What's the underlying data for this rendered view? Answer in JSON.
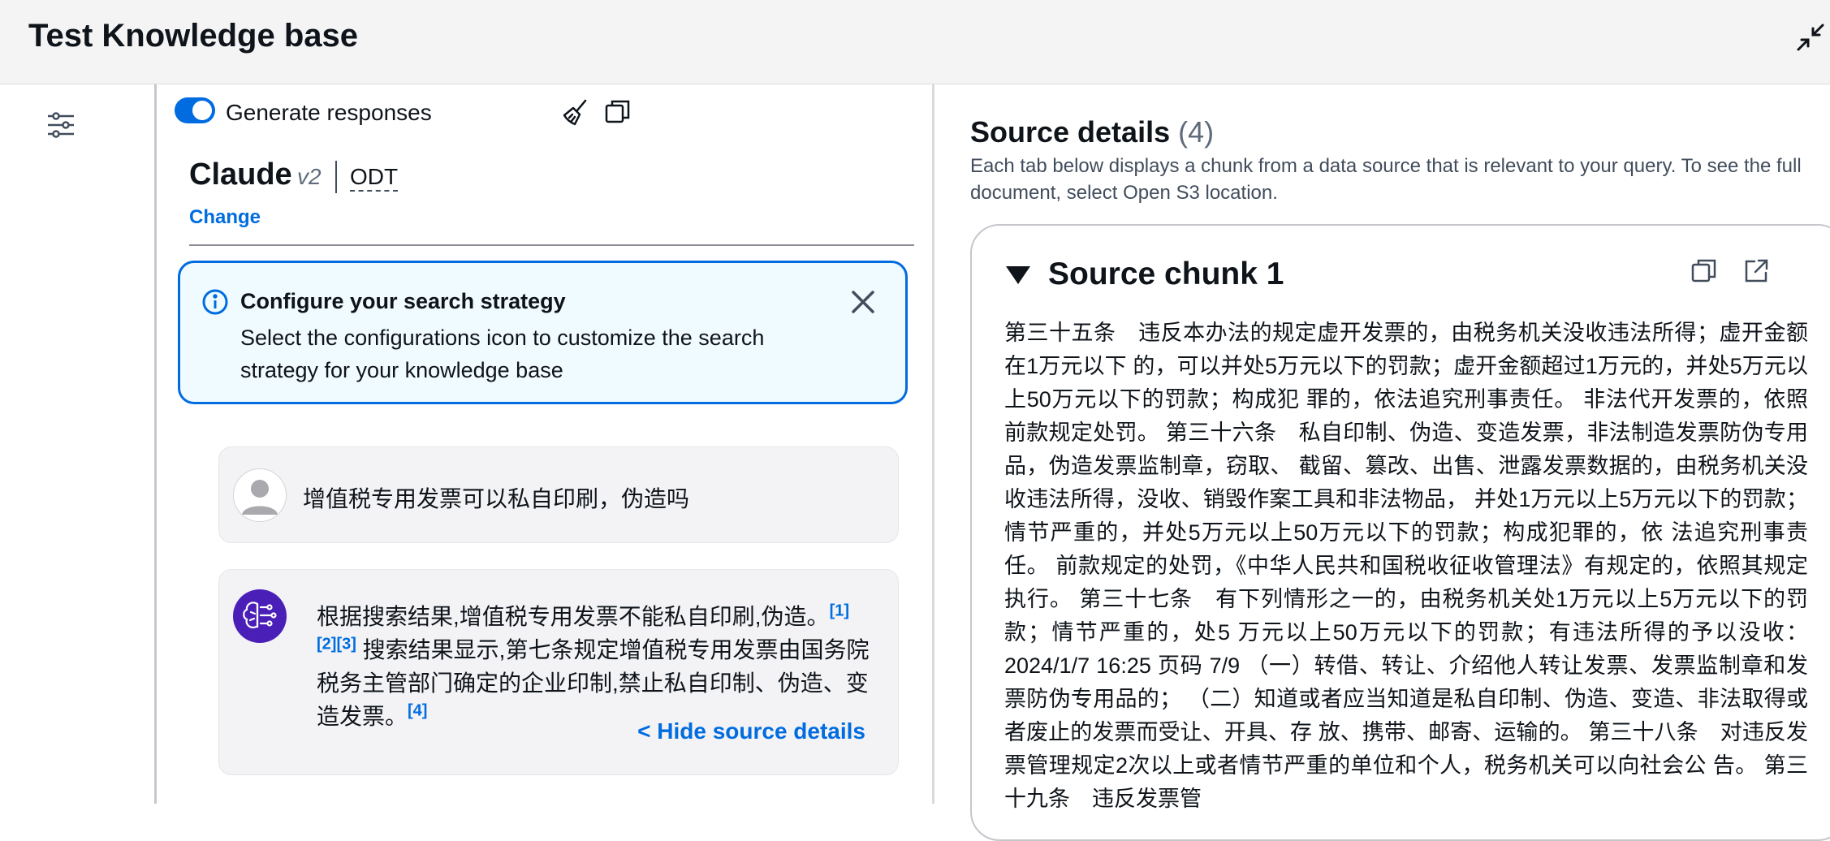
{
  "header": {
    "title": "Test Knowledge base"
  },
  "chat": {
    "generate_label": "Generate responses",
    "generate_enabled": true,
    "model": {
      "name": "Claude",
      "version": "v2",
      "tag": "ODT",
      "change_label": "Change"
    },
    "alert": {
      "title": "Configure your search strategy",
      "body": "Select the configurations icon to customize the search strategy for your knowledge base"
    },
    "user_message": "增值税专用发票可以私自印刷，伪造吗",
    "bot_message": {
      "part1": "根据搜索结果,增值税专用发票不能私自印刷,伪造。",
      "cite1": "[1]",
      "cite2": "[2]",
      "cite3": "[3]",
      "part2": " 搜索结果显示,第七条规定增值税专用发票由国务院税务主管部门确定的企业印制,禁止私自印制、伪造、变造发票。",
      "cite4": "[4]",
      "hide_label": "< Hide source details"
    }
  },
  "source": {
    "title": "Source details",
    "count": "(4)",
    "description": "Each tab below displays a chunk from a data source that is relevant to your query. To see the full document, select Open S3 location.",
    "chunk": {
      "title": "Source chunk 1",
      "text": "第三十五条　违反本办法的规定虚开发票的，由税务机关没收违法所得；虚开金额在1万元以下 的，可以并处5万元以下的罚款；虚开金额超过1万元的，并处5万元以上50万元以下的罚款；构成犯 罪的，依法追究刑事责任。 非法代开发票的，依照前款规定处罚。 第三十六条　私自印制、伪造、变造发票，非法制造发票防伪专用品，伪造发票监制章，窃取、 截留、篡改、出售、泄露发票数据的，由税务机关没收违法所得，没收、销毁作案工具和非法物品， 并处1万元以上5万元以下的罚款；情节严重的，并处5万元以上50万元以下的罚款；构成犯罪的，依 法追究刑事责任。 前款规定的处罚，《中华人民共和国税收征收管理法》有规定的，依照其规定执行。 第三十七条　有下列情形之一的，由税务机关处1万元以上5万元以下的罚款；情节严重的，处5 万元以上50万元以下的罚款；有违法所得的予以没收： 2024/1/7 16:25 页码 7/9 （一）转借、转让、介绍他人转让发票、发票监制章和发票防伪专用品的； （二）知道或者应当知道是私自印制、伪造、变造、非法取得或者废止的发票而受让、开具、存 放、携带、邮寄、运输的。 第三十八条　对违反发票管理规定2次以上或者情节严重的单位和个人，税务机关可以向社会公 告。 第三十九条　违反发票管"
    }
  },
  "colors": {
    "accent": "#006ce0",
    "bot_avatar": "#4a1fb8",
    "alert_bg": "#f0fbff"
  },
  "icons": [
    "collapse-icon",
    "settings-sliders-icon",
    "broom-icon",
    "copy-icon",
    "info-icon",
    "close-icon",
    "user-icon",
    "brain-icon",
    "caret-down-icon",
    "external-link-icon"
  ]
}
